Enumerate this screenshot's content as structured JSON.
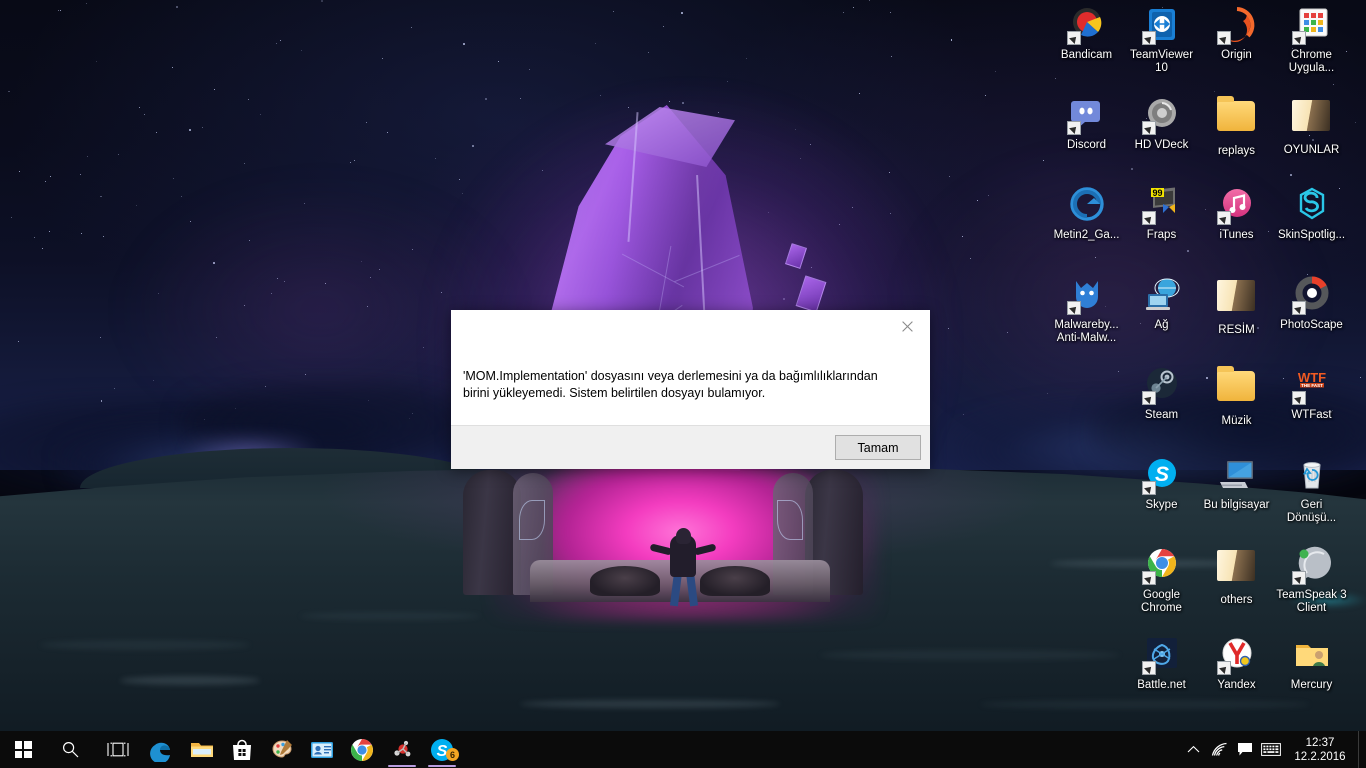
{
  "desktop": {
    "wallpaper_description": "Night fantasy scene: glowing purple crystal monolith and pink magic portal with hooded figure, storm clouds and lightning over dark plains",
    "colors": {
      "crystal_purple": "#9b55dd",
      "portal_pink": "#f43cc0",
      "sky_navy": "#0d1026",
      "ground_teal": "#1c2b33",
      "taskbar_black": "#0b0b0b",
      "accent_underline": "#b99de0"
    },
    "icons": [
      {
        "label": "Bandicam",
        "icon": "bandicam-icon",
        "shortcut": true,
        "col": 0,
        "row": 0
      },
      {
        "label": "TeamViewer 10",
        "icon": "teamviewer-icon",
        "shortcut": true,
        "col": 1,
        "row": 0
      },
      {
        "label": "Origin",
        "icon": "origin-icon",
        "shortcut": true,
        "col": 2,
        "row": 0
      },
      {
        "label": "Chrome Uygula...",
        "icon": "chrome-apps-icon",
        "shortcut": true,
        "col": 3,
        "row": 0
      },
      {
        "label": "Discord",
        "icon": "discord-icon",
        "shortcut": true,
        "col": 0,
        "row": 1
      },
      {
        "label": "HD VDeck",
        "icon": "hd-vdeck-icon",
        "shortcut": true,
        "col": 1,
        "row": 1
      },
      {
        "label": "replays",
        "icon": "folder-icon",
        "shortcut": false,
        "col": 2,
        "row": 1
      },
      {
        "label": "OYUNLAR",
        "icon": "folder-open-icon",
        "shortcut": false,
        "col": 3,
        "row": 1
      },
      {
        "label": "Metin2_Ga...",
        "icon": "metin2-icon",
        "shortcut": false,
        "col": 0,
        "row": 2
      },
      {
        "label": "Fraps",
        "icon": "fraps-icon",
        "shortcut": true,
        "col": 1,
        "row": 2
      },
      {
        "label": "iTunes",
        "icon": "itunes-icon",
        "shortcut": true,
        "col": 2,
        "row": 2
      },
      {
        "label": "SkinSpotlig...",
        "icon": "skinspotlight-icon",
        "shortcut": false,
        "col": 3,
        "row": 2
      },
      {
        "label": "Malwareby... Anti-Malw...",
        "icon": "malwarebytes-icon",
        "shortcut": true,
        "col": 0,
        "row": 3
      },
      {
        "label": "Ağ",
        "icon": "network-icon",
        "shortcut": false,
        "col": 1,
        "row": 3
      },
      {
        "label": "RESİM",
        "icon": "folder-open-icon",
        "shortcut": false,
        "col": 2,
        "row": 3
      },
      {
        "label": "PhotoScape",
        "icon": "photoscape-icon",
        "shortcut": true,
        "col": 3,
        "row": 3
      },
      {
        "label": "Steam",
        "icon": "steam-icon",
        "shortcut": true,
        "col": 1,
        "row": 4
      },
      {
        "label": "Müzik",
        "icon": "folder-icon",
        "shortcut": false,
        "col": 2,
        "row": 4
      },
      {
        "label": "WTFast",
        "icon": "wtfast-icon",
        "shortcut": true,
        "col": 3,
        "row": 4
      },
      {
        "label": "Skype",
        "icon": "skype-icon",
        "shortcut": true,
        "col": 1,
        "row": 5
      },
      {
        "label": "Bu bilgisayar",
        "icon": "this-pc-icon",
        "shortcut": false,
        "col": 2,
        "row": 5
      },
      {
        "label": "Geri Dönüşü...",
        "icon": "recycle-bin-icon",
        "shortcut": false,
        "col": 3,
        "row": 5
      },
      {
        "label": "Google Chrome",
        "icon": "chrome-icon",
        "shortcut": true,
        "col": 1,
        "row": 6
      },
      {
        "label": "others",
        "icon": "folder-open-icon",
        "shortcut": false,
        "col": 2,
        "row": 6
      },
      {
        "label": "TeamSpeak 3 Client",
        "icon": "teamspeak-icon",
        "shortcut": true,
        "col": 3,
        "row": 6
      },
      {
        "label": "Battle.net",
        "icon": "battlenet-icon",
        "shortcut": true,
        "col": 1,
        "row": 7
      },
      {
        "label": "Yandex",
        "icon": "yandex-icon",
        "shortcut": true,
        "col": 2,
        "row": 7
      },
      {
        "label": "Mercury",
        "icon": "folder-user-icon",
        "shortcut": false,
        "col": 3,
        "row": 7
      }
    ]
  },
  "dialog": {
    "message": "'MOM.Implementation' dosyasını veya derlemesini ya da bağımlılıklarından birini yükleyemedi. Sistem belirtilen dosyayı bulamıyor.",
    "ok_label": "Tamam",
    "close_icon": "close-icon",
    "title": ""
  },
  "taskbar": {
    "start_icon": "windows-start-icon",
    "search_icon": "search-icon",
    "taskview_icon": "task-view-icon",
    "apps": [
      {
        "name": "Microsoft Edge",
        "icon": "edge-icon",
        "running": false
      },
      {
        "name": "File Explorer",
        "icon": "file-explorer-icon",
        "running": false
      },
      {
        "name": "Microsoft Store",
        "icon": "store-icon",
        "running": false
      },
      {
        "name": "Paint",
        "icon": "paint-icon",
        "running": false
      },
      {
        "name": "Contact Support",
        "icon": "contact-support-icon",
        "running": false
      },
      {
        "name": "Google Chrome",
        "icon": "chrome-icon",
        "running": false
      },
      {
        "name": "Metin2",
        "icon": "metin2-taskbar-icon",
        "running": true
      },
      {
        "name": "Skype",
        "icon": "skype-taskbar-icon",
        "running": true,
        "badge": "6"
      }
    ],
    "tray": [
      {
        "name": "show-hidden-icons",
        "icon": "chevron-up-icon"
      },
      {
        "name": "network",
        "icon": "wifi-icon"
      },
      {
        "name": "action-center",
        "icon": "action-center-icon"
      },
      {
        "name": "touch-keyboard",
        "icon": "keyboard-icon"
      }
    ],
    "clock": {
      "time": "12:37",
      "date": "12.2.2016"
    }
  }
}
